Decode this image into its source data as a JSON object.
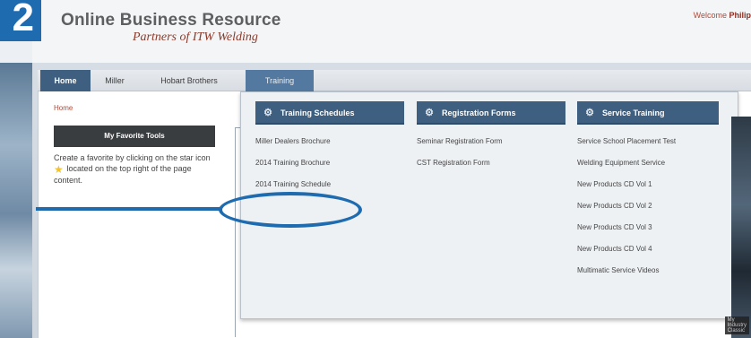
{
  "step_badge": "2",
  "header": {
    "title": "Online Business Resource",
    "tagline": "Partners of ITW Welding",
    "welcome_prefix": "Welcome",
    "welcome_name": "Philip"
  },
  "nav": {
    "items": [
      {
        "label": "Home"
      },
      {
        "label": "Miller"
      },
      {
        "label": "Hobart Brothers"
      },
      {
        "label": "Training"
      }
    ]
  },
  "breadcrumb": "Home",
  "favorites": {
    "title": "My Favorite Tools",
    "text_part1": "Create a favorite by clicking on the star icon",
    "text_part2": "located on the top right of the page content."
  },
  "dropdown": {
    "columns": [
      {
        "heading": "Training Schedules",
        "links": [
          "Miller Dealers Brochure",
          "2014 Training Brochure",
          "2014 Training Schedule"
        ]
      },
      {
        "heading": "Registration Forms",
        "links": [
          "Seminar Registration Form",
          "CST Registration Form"
        ]
      },
      {
        "heading": "Service Training",
        "links": [
          "Service School Placement Test",
          "Welding Equipment Service",
          "New Products CD Vol 1",
          "New Products CD Vol 2",
          "New Products CD Vol 3",
          "New Products CD Vol 4",
          "Multimatic Service Videos"
        ]
      }
    ]
  },
  "corner_label": "My Industry Classic",
  "colors": {
    "accent_blue": "#1f6bb0",
    "nav_active": "#3e5f80",
    "brand_red": "#8d3a2b"
  }
}
